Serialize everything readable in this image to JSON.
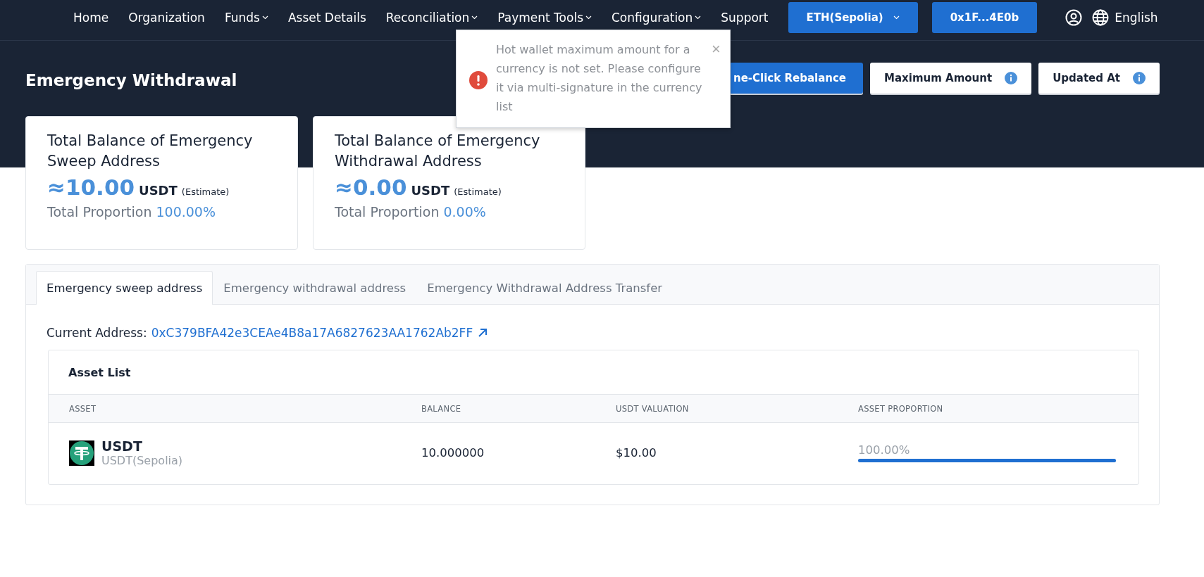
{
  "nav": {
    "items": [
      {
        "label": "Home",
        "dropdown": false
      },
      {
        "label": "Organization",
        "dropdown": false
      },
      {
        "label": "Funds",
        "dropdown": true
      },
      {
        "label": "Asset Details",
        "dropdown": false
      },
      {
        "label": "Reconciliation",
        "dropdown": true
      },
      {
        "label": "Payment Tools",
        "dropdown": true
      },
      {
        "label": "Configuration",
        "dropdown": true
      },
      {
        "label": "Support",
        "dropdown": false
      }
    ],
    "network": "ETH(Sepolia)",
    "account": "0x1F...4E0b",
    "language": "English"
  },
  "header": {
    "title": "Emergency Withdrawal",
    "buttons": [
      {
        "label": "ne-Click Rebalance",
        "kind": "primary"
      },
      {
        "label": "Maximum Amount",
        "kind": "info"
      },
      {
        "label": "Updated At",
        "kind": "info"
      }
    ]
  },
  "cards": [
    {
      "title": "Total Balance of Emergency Sweep Address",
      "amount": "≈10.00",
      "unit": "USDT",
      "note": "(Estimate)",
      "proportion_label": "Total Proportion",
      "proportion": "100.00%"
    },
    {
      "title": "Total Balance of Emergency Withdrawal Address",
      "amount": "≈0.00",
      "unit": "USDT",
      "note": "(Estimate)",
      "proportion_label": "Total Proportion",
      "proportion": "0.00%"
    }
  ],
  "tabs": [
    {
      "label": "Emergency sweep address",
      "selected": true
    },
    {
      "label": "Emergency withdrawal address",
      "selected": false
    },
    {
      "label": "Emergency Withdrawal Address Transfer",
      "selected": false
    }
  ],
  "current_address": {
    "label": "Current Address:",
    "value": "0xC379BFA42e3CEAe4B8a17A6827623AA1762Ab2FF"
  },
  "asset_list": {
    "title": "Asset List",
    "columns": [
      "ASSET",
      "BALANCE",
      "USDT VALUATION",
      "ASSET PROPORTION"
    ],
    "rows": [
      {
        "symbol": "USDT",
        "network": "USDT(Sepolia)",
        "balance": "10.000000",
        "valuation": "$10.00",
        "proportion": "100.00%",
        "level": 1
      }
    ]
  },
  "toast": {
    "message": "Hot wallet maximum amount for a currency is not set. Please configure it via multi-signature in the currency list",
    "close": "×"
  }
}
